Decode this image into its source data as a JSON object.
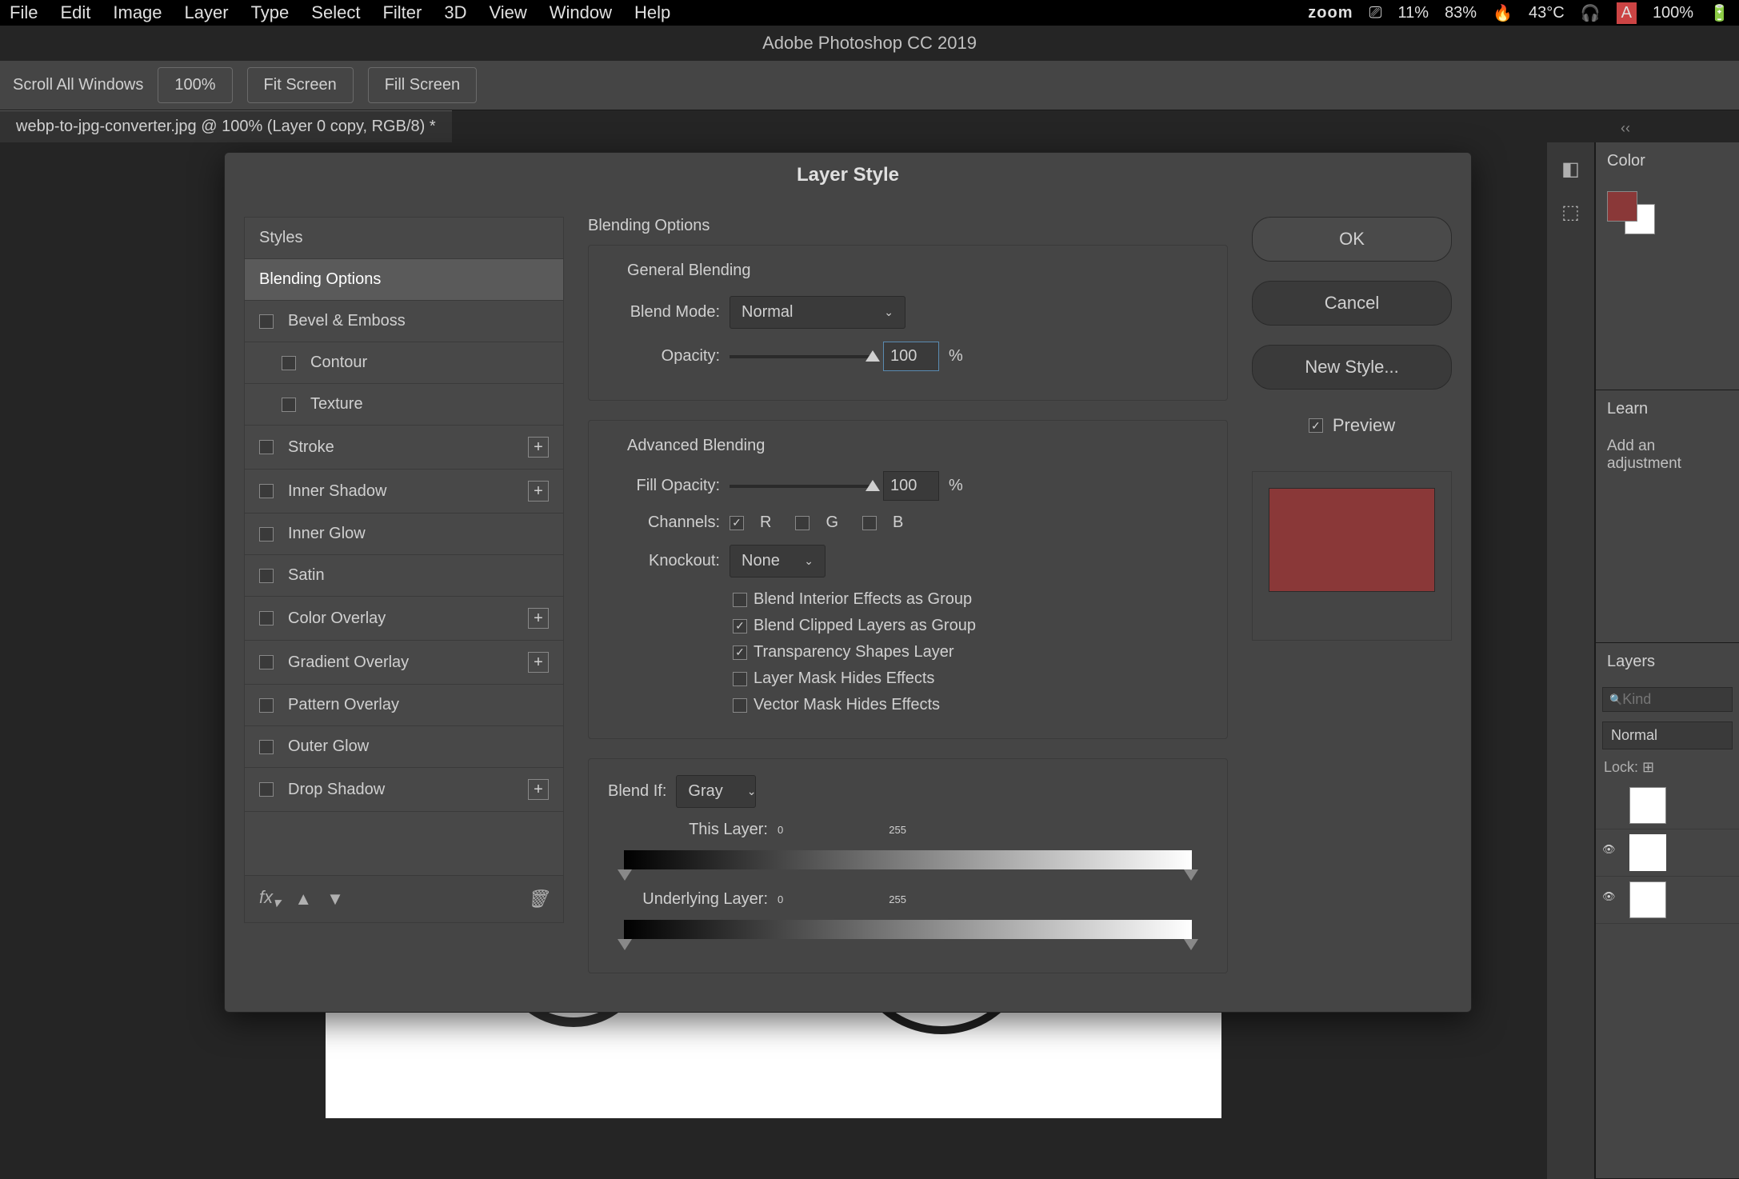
{
  "menubar": {
    "items": [
      "File",
      "Edit",
      "Image",
      "Layer",
      "Type",
      "Select",
      "Filter",
      "3D",
      "View",
      "Window",
      "Help"
    ],
    "right": {
      "zoom_logo": "zoom",
      "cpu": "11%",
      "mem": "83%",
      "temp": "43°C",
      "batt": "100%"
    }
  },
  "titlebar": "Adobe Photoshop CC 2019",
  "optionsbar": {
    "scroll_all": "Scroll All Windows",
    "zoom_100": "100%",
    "fit": "Fit Screen",
    "fill": "Fill Screen"
  },
  "doctab": "webp-to-jpg-converter.jpg @ 100% (Layer 0 copy, RGB/8) *",
  "dialog": {
    "title": "Layer Style",
    "sidebar": {
      "header": "Styles",
      "items": [
        {
          "label": "Blending Options",
          "selected": true,
          "checkbox": false
        },
        {
          "label": "Bevel & Emboss",
          "checkbox": true
        },
        {
          "label": "Contour",
          "checkbox": true,
          "sub": true
        },
        {
          "label": "Texture",
          "checkbox": true,
          "sub": true
        },
        {
          "label": "Stroke",
          "checkbox": true,
          "add": true
        },
        {
          "label": "Inner Shadow",
          "checkbox": true,
          "add": true
        },
        {
          "label": "Inner Glow",
          "checkbox": true
        },
        {
          "label": "Satin",
          "checkbox": true
        },
        {
          "label": "Color Overlay",
          "checkbox": true,
          "add": true
        },
        {
          "label": "Gradient Overlay",
          "checkbox": true,
          "add": true
        },
        {
          "label": "Pattern Overlay",
          "checkbox": true
        },
        {
          "label": "Outer Glow",
          "checkbox": true
        },
        {
          "label": "Drop Shadow",
          "checkbox": true,
          "add": true
        }
      ]
    },
    "center": {
      "main_label": "Blending Options",
      "general": {
        "title": "General Blending",
        "blend_mode_label": "Blend Mode:",
        "blend_mode_value": "Normal",
        "opacity_label": "Opacity:",
        "opacity_value": "100",
        "pct": "%"
      },
      "advanced": {
        "title": "Advanced Blending",
        "fill_label": "Fill Opacity:",
        "fill_value": "100",
        "channels_label": "Channels:",
        "ch_r": "R",
        "ch_g": "G",
        "ch_b": "B",
        "knockout_label": "Knockout:",
        "knockout_value": "None",
        "opt1": "Blend Interior Effects as Group",
        "opt2": "Blend Clipped Layers as Group",
        "opt3": "Transparency Shapes Layer",
        "opt4": "Layer Mask Hides Effects",
        "opt5": "Vector Mask Hides Effects"
      },
      "blendif": {
        "label": "Blend If:",
        "value": "Gray",
        "this_label": "This Layer:",
        "this_lo": "0",
        "this_hi": "255",
        "under_label": "Underlying Layer:",
        "under_lo": "0",
        "under_hi": "255"
      }
    },
    "right": {
      "ok": "OK",
      "cancel": "Cancel",
      "new_style": "New Style...",
      "preview": "Preview"
    }
  },
  "panels": {
    "color": "Color",
    "learn": "Learn",
    "learn_sub": "Add an adjustment",
    "layers": "Layers",
    "layers_search_ph": "Kind",
    "layers_blend": "Normal",
    "layers_lock": "Lock:"
  }
}
